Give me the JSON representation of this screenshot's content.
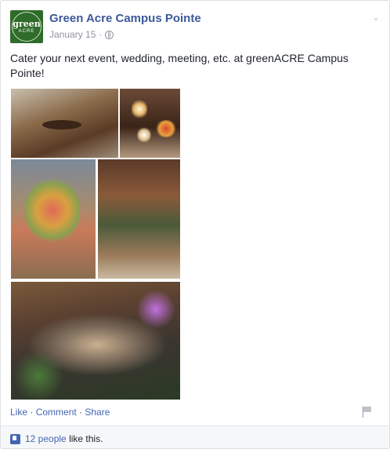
{
  "post": {
    "page_name": "Green Acre Campus Pointe",
    "date": "January 15",
    "separator": "·",
    "text": "Cater your next event, wedding, meeting, etc. at greenACRE Campus Pointe!",
    "avatar": {
      "line1": "green",
      "line2": "ACRE",
      "color": "#2f6b2a"
    },
    "photo_count": 5
  },
  "actions": {
    "like": "Like",
    "dot1": " · ",
    "comment": "Comment",
    "dot2": " · ",
    "share": "Share"
  },
  "likes": {
    "count_label": "12 people",
    "suffix": "like this."
  },
  "colors": {
    "link": "#3b5998",
    "action_link": "#4267b2",
    "meta": "#90949c"
  },
  "icons": [
    "globe-icon",
    "chevron-down-icon",
    "flag-icon",
    "thumbs-up-icon"
  ]
}
